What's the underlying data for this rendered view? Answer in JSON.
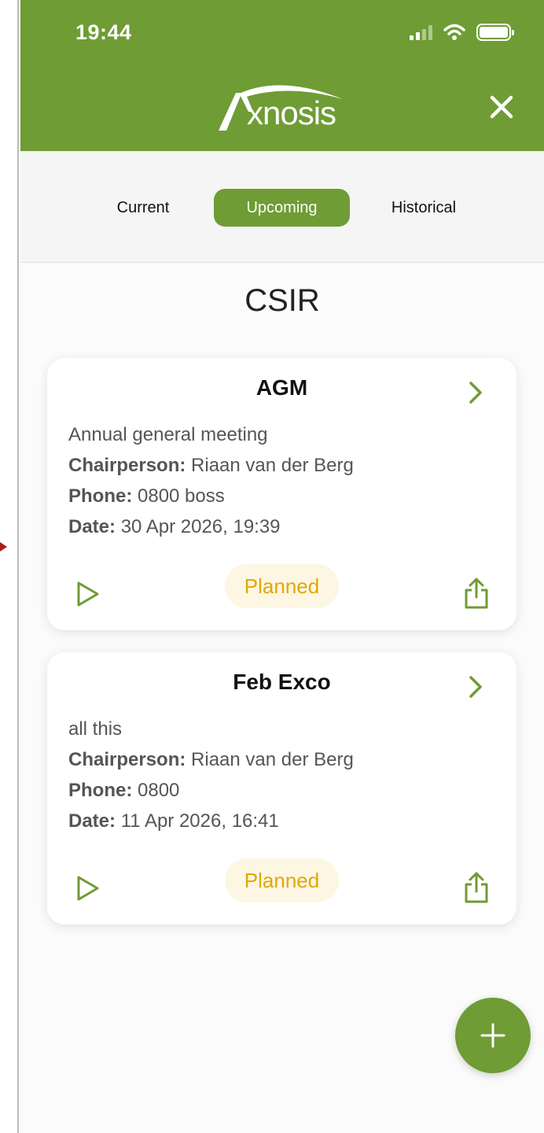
{
  "status_bar": {
    "time": "19:44"
  },
  "header": {
    "logo_text": "xnosis",
    "logo_letter": "A",
    "logo_name": "axnosis-logo",
    "close_icon": "close-icon"
  },
  "tabs": [
    {
      "label": "Current",
      "active": false
    },
    {
      "label": "Upcoming",
      "active": true
    },
    {
      "label": "Historical",
      "active": false
    }
  ],
  "org_name": "CSIR",
  "meetings": [
    {
      "title": "AGM",
      "description": "Annual general meeting",
      "chairperson_label": "Chairperson:",
      "chairperson": "Riaan van der Berg",
      "phone_label": "Phone:",
      "phone": "0800 boss",
      "date_label": "Date:",
      "date": "30 Apr 2026, 19:39",
      "status": "Planned"
    },
    {
      "title": "Feb Exco",
      "description": "all this",
      "chairperson_label": "Chairperson:",
      "chairperson": "Riaan van der Berg",
      "phone_label": "Phone:",
      "phone": "0800",
      "date_label": "Date:",
      "date": "11 Apr 2026, 16:41",
      "status": "Planned"
    }
  ],
  "fab": {
    "icon": "plus-icon"
  },
  "colors": {
    "brand_green": "#6f9c34",
    "planned_text": "#e0a800",
    "planned_bg": "#fdf6e3"
  }
}
